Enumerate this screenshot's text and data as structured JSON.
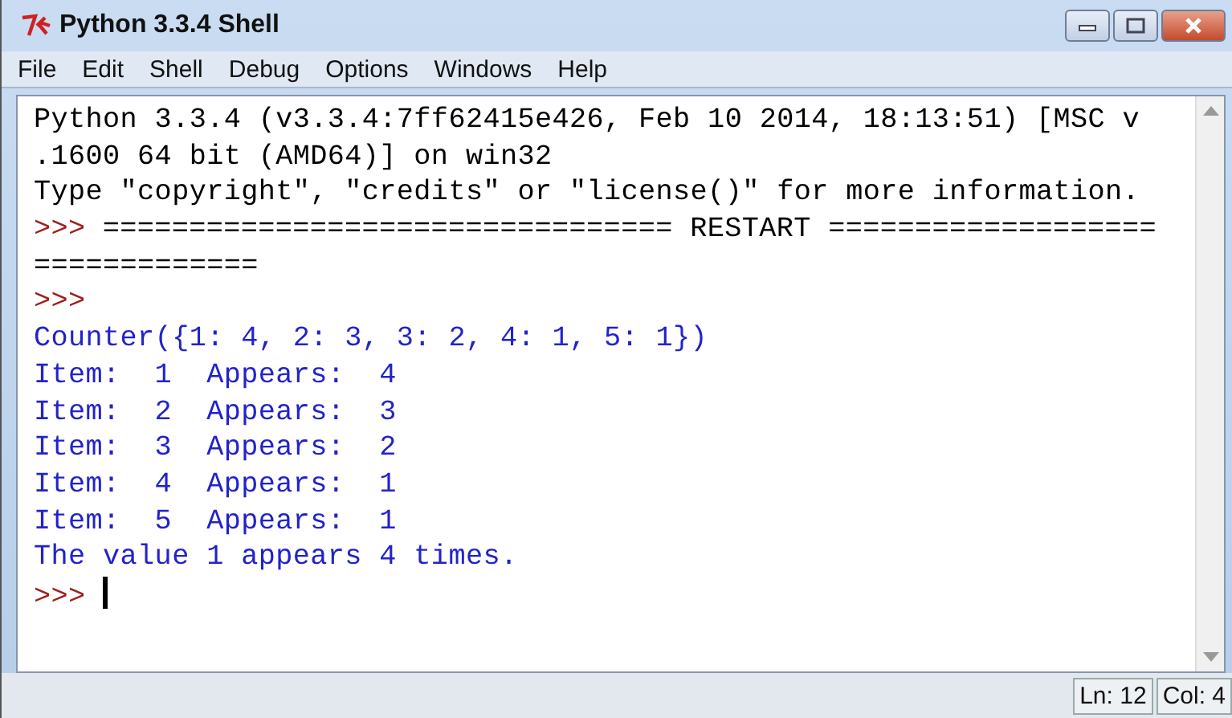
{
  "window": {
    "title": "Python 3.3.4 Shell"
  },
  "menu": [
    "File",
    "Edit",
    "Shell",
    "Debug",
    "Options",
    "Windows",
    "Help"
  ],
  "shell_lines": [
    [
      {
        "kind": "output",
        "text": "Python 3.3.4 (v3.3.4:7ff62415e426, Feb 10 2014, 18:13:51) [MSC v"
      }
    ],
    [
      {
        "kind": "output",
        "text": ".1600 64 bit (AMD64)] on win32"
      }
    ],
    [
      {
        "kind": "output",
        "text": "Type \"copyright\", \"credits\" or \"license()\" for more information."
      }
    ],
    [
      {
        "kind": "prompt",
        "text": ">>>"
      },
      {
        "kind": "output",
        "text": "================================= RESTART ==================="
      }
    ],
    [
      {
        "kind": "output",
        "text": "============="
      }
    ],
    [
      {
        "kind": "prompt",
        "text": ">>>"
      }
    ],
    [
      {
        "kind": "stdout",
        "text": "Counter({1: 4, 2: 3, 3: 2, 4: 1, 5: 1})"
      }
    ],
    [
      {
        "kind": "stdout",
        "text": "Item:  1  Appears:  4"
      }
    ],
    [
      {
        "kind": "stdout",
        "text": "Item:  2  Appears:  3"
      }
    ],
    [
      {
        "kind": "stdout",
        "text": "Item:  3  Appears:  2"
      }
    ],
    [
      {
        "kind": "stdout",
        "text": "Item:  4  Appears:  1"
      }
    ],
    [
      {
        "kind": "stdout",
        "text": "Item:  5  Appears:  1"
      }
    ],
    [
      {
        "kind": "stdout",
        "text": "The value 1 appears 4 times."
      }
    ],
    [
      {
        "kind": "prompt",
        "text": ">>>"
      },
      {
        "kind": "cursor"
      }
    ]
  ],
  "status_bar": {
    "line": "Ln: 12",
    "column": "Col: 4"
  }
}
